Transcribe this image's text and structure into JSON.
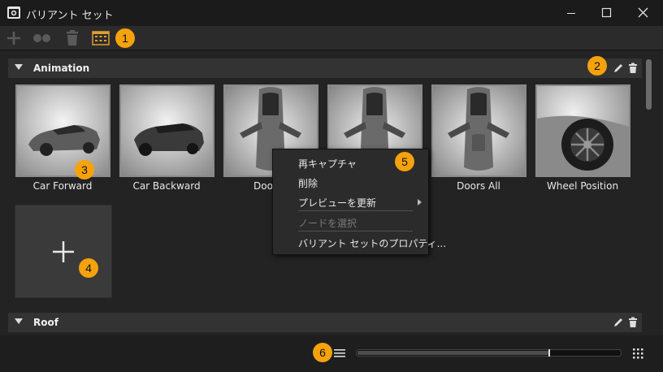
{
  "window": {
    "title": "バリアント セット"
  },
  "groups": [
    {
      "name": "Animation"
    },
    {
      "name": "Roof"
    }
  ],
  "variants": [
    {
      "label": "Car Forward"
    },
    {
      "label": "Car Backward"
    },
    {
      "label": "Door D"
    },
    {
      "label": ""
    },
    {
      "label": "Doors All"
    },
    {
      "label": "Wheel Position"
    }
  ],
  "context_menu": {
    "items": [
      {
        "label": "再キャプチャ",
        "enabled": true
      },
      {
        "label": "削除",
        "enabled": true
      },
      {
        "label": "プレビューを更新",
        "enabled": true,
        "submenu": true
      },
      {
        "label": "ノードを選択",
        "enabled": false
      },
      {
        "label": "バリアント セットのプロパティ...",
        "enabled": true
      }
    ]
  },
  "callouts": [
    "1",
    "2",
    "3",
    "4",
    "5",
    "6"
  ],
  "thumbnail_size": {
    "fraction": 0.73
  },
  "colors": {
    "callout": "#f5a20c",
    "background": "#232323",
    "header": "#333333",
    "accent": "#e0a030"
  }
}
